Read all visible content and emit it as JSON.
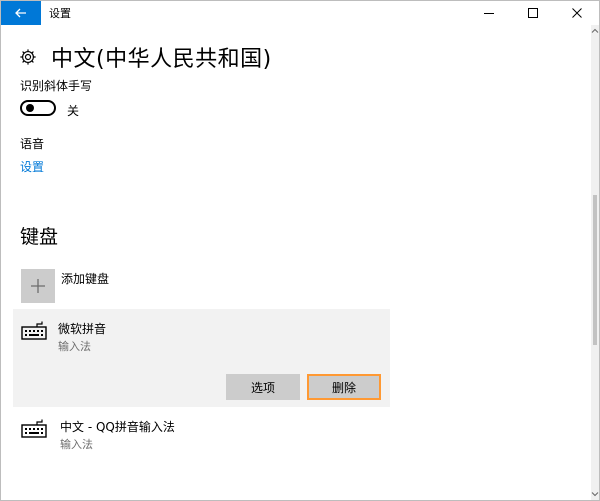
{
  "window": {
    "title": "设置"
  },
  "header": {
    "title": "中文(中华人民共和国)"
  },
  "handwriting": {
    "label": "识别斜体手写",
    "toggle_state": "关"
  },
  "speech": {
    "label": "语音",
    "link": "设置"
  },
  "keyboards": {
    "section_title": "键盘",
    "add_label": "添加键盘",
    "items": [
      {
        "name": "微软拼音",
        "sub": "输入法",
        "buttons": {
          "options": "选项",
          "remove": "删除"
        }
      },
      {
        "name": "中文 - QQ拼音输入法",
        "sub": "输入法"
      }
    ]
  },
  "colors": {
    "accent": "#0078d7",
    "selected_bg": "#f2f2f2",
    "button_bg": "#cccccc",
    "highlight_border": "#ff9933"
  },
  "icons": [
    "back-arrow-icon",
    "minimize-icon",
    "maximize-icon",
    "close-icon",
    "gear-icon",
    "plus-icon",
    "keyboard-icon"
  ]
}
